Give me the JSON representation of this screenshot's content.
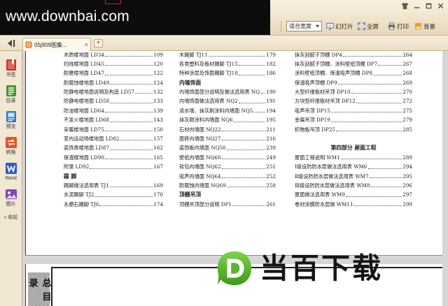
{
  "watermarks": {
    "site_url": "www.downbai.com",
    "logo_text": "当百下载"
  },
  "window_controls": [
    {
      "icon": "skin-icon"
    },
    {
      "icon": "minimize-icon"
    },
    {
      "icon": "restore-icon"
    },
    {
      "icon": "close-icon"
    }
  ],
  "toolbar": {
    "zoom_select": {
      "value": "适合宽度",
      "icon": "chevron-down-icon"
    },
    "buttons": [
      {
        "label": "幻灯片",
        "icon": "slideshow-icon"
      },
      {
        "label": "全屏",
        "icon": "fullscreen-icon"
      },
      {
        "label": "打印",
        "icon": "print-icon"
      },
      {
        "label": "背景",
        "icon": "background-icon"
      }
    ]
  },
  "tabbar": {
    "toggle_icon": "sidebar-toggle-icon",
    "tabs": [
      {
        "label": "05j909图集...",
        "icon": "pdf-file-icon",
        "close": "×"
      }
    ],
    "new_tab": "+"
  },
  "sidebar": {
    "items": [
      {
        "label": "书签",
        "icon": "bookmark-icon"
      },
      {
        "label": "目录",
        "icon": "toc-icon"
      },
      {
        "label": "预览",
        "icon": "preview-icon"
      },
      {
        "label": "转换",
        "icon": "convert-icon"
      },
      {
        "label": "Word",
        "icon": "word-icon"
      },
      {
        "label": "图片",
        "icon": "picture-icon"
      }
    ],
    "collapse_label": "« 收起"
  },
  "page_content": {
    "toc_columns": [
      [
        {
          "title": "木质楼地面 LD34",
          "page": "109"
        },
        {
          "title": "灼线楼地面 LD45",
          "page": "120"
        },
        {
          "title": "耐磨楼地面 LD47",
          "page": "122"
        },
        {
          "title": "耐腐蚀楼地面 LD49",
          "page": "124"
        },
        {
          "title": "防静电楼地面说明及构造 LD57",
          "page": "132"
        },
        {
          "title": "防静电楼地面 LD58",
          "page": "133"
        },
        {
          "title": "防油楼地面 LD64",
          "page": "139"
        },
        {
          "title": "不发火楼地面 LD68",
          "page": "143"
        },
        {
          "title": "采暖楼地面 LD75",
          "page": "150"
        },
        {
          "title": "室内运动场楼地面 LD82",
          "page": "157"
        },
        {
          "title": "装饰类楼地面 LD87",
          "page": "162"
        },
        {
          "title": "保温楼地面 LD90",
          "page": "165"
        },
        {
          "title": "附录 LD92",
          "page": "167"
        },
        {
          "heading": "踢 脚"
        },
        {
          "title": "踢脚做法选用表 TJ1",
          "page": "169"
        },
        {
          "title": "水泥踢脚 TJ2",
          "page": "170"
        },
        {
          "title": "水磨石踢脚 TJ6",
          "page": "174"
        }
      ],
      [
        {
          "title": "木踢脚 TJ11",
          "page": "179"
        },
        {
          "title": "各类塑料及板材踢脚 TJ15",
          "page": "182"
        },
        {
          "title": "特种涂层及饰面踢脚 TJ18",
          "page": "186"
        },
        {
          "heading": "内墙饰面"
        },
        {
          "title": "内墙饰面部分说明及做法选用表 NQ1",
          "page": "190"
        },
        {
          "title": "内墙饰面做法选用表 NQ2",
          "page": "191"
        },
        {
          "title": "清水墙、抹灰刷涂料内墙面 NQ5",
          "page": "194"
        },
        {
          "title": "抹灰刷涂料内墙面 NQ6",
          "page": "195"
        },
        {
          "title": "石材内墙面 NQ22",
          "page": "211"
        },
        {
          "title": "面砖内墙面 NQ27",
          "page": "216"
        },
        {
          "title": "装饰板内墙面 NQ50",
          "page": "239"
        },
        {
          "title": "壁纸内墙面 NQ60",
          "page": "249"
        },
        {
          "title": "软包内墙面 NQ62",
          "page": "251"
        },
        {
          "title": "吸声内墙面 NQ64",
          "page": "252"
        },
        {
          "title": "耐腐蚀内墙面 NQ69",
          "page": "258"
        },
        {
          "heading": "顶棚吊顶"
        },
        {
          "title": "顶棚吊顶部分说明 DP1",
          "page": "261"
        }
      ],
      [
        {
          "title": "抹灰刮腻子顶棚 DP4",
          "page": "264"
        },
        {
          "title": "抹灰刮腻子顶棚、涂料壁纸顶棚 DP7",
          "page": "267"
        },
        {
          "title": "涂料壁纸顶棚、保温吸声顶棚 DP8",
          "page": "268"
        },
        {
          "title": "保温吸声顶棚 DP9",
          "page": "269"
        },
        {
          "title": "大型纤维板材吊顶 DP10",
          "page": "270"
        },
        {
          "title": "方块型纤维板材吊顶 DP12",
          "page": "272"
        },
        {
          "title": "吸声吊顶 DP15",
          "page": "275"
        },
        {
          "title": "金属吊顶 DP19",
          "page": "279"
        },
        {
          "title": "织物板吊顶 DP25",
          "page": "285"
        },
        null,
        {
          "heading": "第四部分 屋面工程"
        },
        {
          "title": "屋面工程说明 WM1",
          "page": "289"
        },
        {
          "title": "Ⅰ级设防防水层做法选用表 WM6",
          "page": "294"
        },
        {
          "title": "Ⅱ级设防防水层做法选用表 WM7",
          "page": "295"
        },
        {
          "title": "Ⅲ级设防防水层做法选用表 WM8",
          "page": "296"
        },
        {
          "title": "屋面做法选用表 WM9",
          "page": "297"
        },
        {
          "title": "卷材涂膜防水层做 WM11",
          "page": "299"
        }
      ]
    ],
    "next_page_side_title": "总目录"
  },
  "colors": {
    "toolbar": "#efe2c7",
    "banner": "#0c0c0c",
    "sidebar": "#f1e7d3",
    "logo_green": "#5ab42e"
  }
}
